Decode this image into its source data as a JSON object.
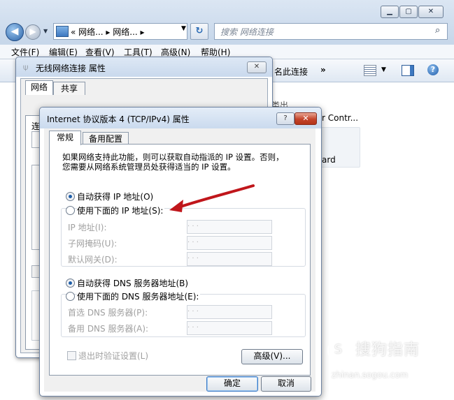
{
  "explorer": {
    "address_crumbs": "« 网络... ▸ 网络... ▸",
    "search_placeholder": "搜索 网络连接",
    "menu": [
      "文件(F)",
      "编辑(E)",
      "查看(V)",
      "工具(T)",
      "高级(N)",
      "帮助(H)"
    ],
    "cmd_fragment": "名此连接",
    "cmd_more": "»",
    "right_fragment_1": "r Contr...",
    "right_fragment_2": "ard",
    "right_fragment_3": "类出"
  },
  "props_dialog": {
    "title": "无线网络连接 属性",
    "tabs": [
      "网络",
      "共享"
    ],
    "connect_label": "连接时使用:",
    "close_glyph": "✕"
  },
  "tcp_dialog": {
    "title": "Internet 协议版本 4 (TCP/IPv4) 属性",
    "help_glyph": "?",
    "close_glyph": "✕",
    "tabs": [
      "常规",
      "备用配置"
    ],
    "intro_line1": "如果网络支持此功能，则可以获取自动指派的 IP 设置。否则，",
    "intro_line2": "您需要从网络系统管理员处获得适当的 IP 设置。",
    "auto_ip": "自动获得 IP 地址(O)",
    "manual_ip": "使用下面的 IP 地址(S):",
    "ip_label": "IP 地址(I):",
    "mask_label": "子网掩码(U):",
    "gateway_label": "默认网关(D):",
    "ip_placeholder": ".   .   .",
    "auto_dns": "自动获得 DNS 服务器地址(B)",
    "manual_dns": "使用下面的 DNS 服务器地址(E):",
    "dns1_label": "首选 DNS 服务器(P):",
    "dns2_label": "备用 DNS 服务器(A):",
    "validate_label": "退出时验证设置(L)",
    "advanced_button": "高级(V)...",
    "ok_button": "确定",
    "cancel_button": "取消",
    "auto_ip_selected": true,
    "auto_dns_selected": true
  },
  "watermark": {
    "brand": "搜狗指南",
    "url": "zhinan.sogou.com"
  },
  "colors": {
    "accent": "#3d7bc6",
    "close_red": "#c4442b",
    "annotation_arrow": "#c0161b"
  }
}
